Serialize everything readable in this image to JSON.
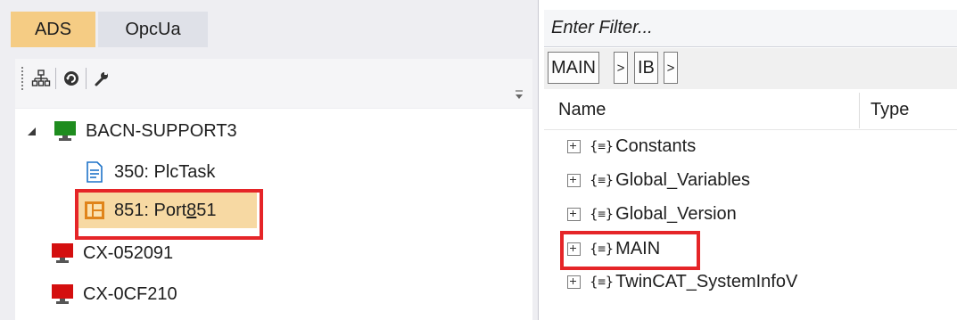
{
  "tabs": {
    "ads": "ADS",
    "opcua": "OpcUa"
  },
  "toolbar_icons": [
    "network-topology-icon",
    "refresh-icon",
    "wrench-icon"
  ],
  "tree": {
    "root": {
      "label": "BACN-SUPPORT3",
      "status_color": "#1e8c1e"
    },
    "tasks": [
      {
        "label": "350: PlcTask",
        "icon": "task-document-icon"
      },
      {
        "label_prefix": "851: Port",
        "label_mnemonic": "8",
        "label_suffix": "51",
        "icon": "plc-port-icon",
        "selected": true,
        "highlighted": true
      }
    ],
    "other_targets": [
      {
        "label": "CX-052091",
        "status_color": "#d40f0f"
      },
      {
        "label": "CX-0CF210",
        "status_color": "#d40f0f"
      }
    ]
  },
  "filter": {
    "placeholder": "Enter Filter..."
  },
  "breadcrumb": {
    "items": [
      "MAIN",
      "IB"
    ],
    "separator": ">"
  },
  "columns": {
    "name": "Name",
    "type": "Type"
  },
  "symbols": [
    {
      "label": "Constants",
      "icon": "namespace-icon",
      "highlighted": false
    },
    {
      "label": "Global_Variables",
      "icon": "namespace-icon",
      "highlighted": false
    },
    {
      "label": "Global_Version",
      "icon": "namespace-icon",
      "highlighted": false
    },
    {
      "label": "MAIN",
      "icon": "namespace-icon",
      "highlighted": true
    },
    {
      "label": "TwinCAT_SystemInfoV",
      "icon": "namespace-icon",
      "highlighted": false
    }
  ],
  "colors": {
    "highlight_box": "#e52528",
    "selected_row": "#f7d9a3",
    "active_tab": "#f5cc84"
  }
}
